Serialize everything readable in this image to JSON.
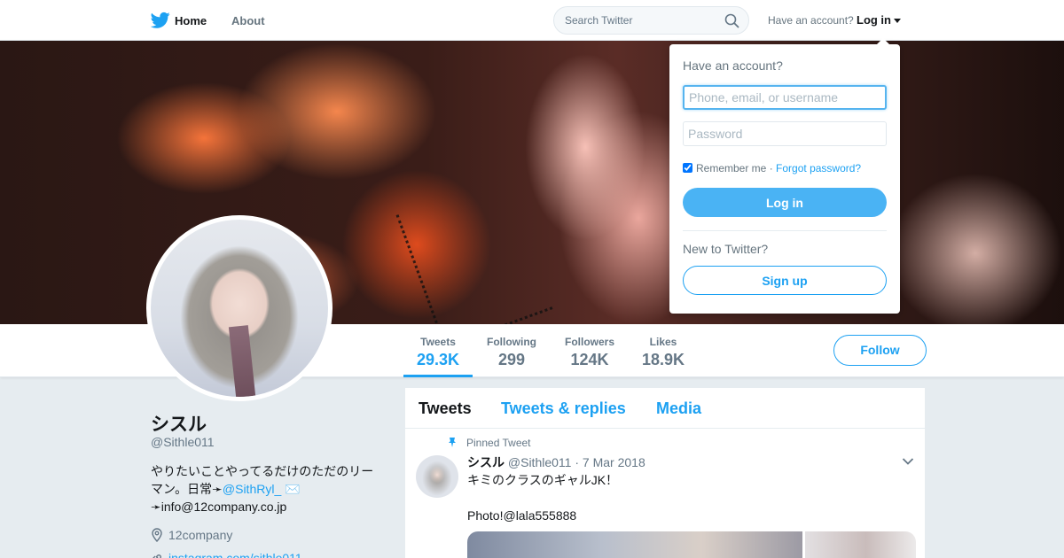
{
  "colors": {
    "accent": "#1da1f2",
    "background": "#e6ecf0",
    "text_primary": "#14171a",
    "text_secondary": "#657786"
  },
  "topbar": {
    "logo_icon": "twitter-bird-icon",
    "home_label": "Home",
    "about_label": "About",
    "search_placeholder": "Search Twitter",
    "search_icon": "search-icon",
    "have_account_text": "Have an account?",
    "login_label": "Log in"
  },
  "login_dropdown": {
    "title": "Have an account?",
    "username_placeholder": "Phone, email, or username",
    "password_placeholder": "Password",
    "remember_label": "Remember me",
    "separator": "·",
    "forgot_label": "Forgot password?",
    "remember_checked": true,
    "login_button": "Log in",
    "new_to_twitter": "New to Twitter?",
    "signup_button": "Sign up"
  },
  "profile_nav": {
    "stats": [
      {
        "label": "Tweets",
        "value": "29.3K",
        "active": true
      },
      {
        "label": "Following",
        "value": "299",
        "active": false
      },
      {
        "label": "Followers",
        "value": "124K",
        "active": false
      },
      {
        "label": "Likes",
        "value": "18.9K",
        "active": false
      }
    ],
    "follow_button": "Follow"
  },
  "profile": {
    "name": "シスル",
    "handle": "@Sithle011",
    "bio_line1": "やりたいことやってるだけのただのリー",
    "bio_line2_prefix": "マン。日常➛",
    "bio_link": "@SithRyl_",
    "bio_line2_suffix": " ✉️",
    "bio_line3": "➛info@12company.co.jp",
    "location": "12company",
    "website": "instagram.com/sithle011"
  },
  "timeline": {
    "tabs": [
      "Tweets",
      "Tweets & replies",
      "Media"
    ],
    "pinned_label": "Pinned Tweet",
    "tweet": {
      "name": "シスル",
      "handle": "@Sithle011",
      "date": "7 Mar 2018",
      "text": "キミのクラスのギャルJK！\n\nPhoto!@lala555888"
    }
  }
}
